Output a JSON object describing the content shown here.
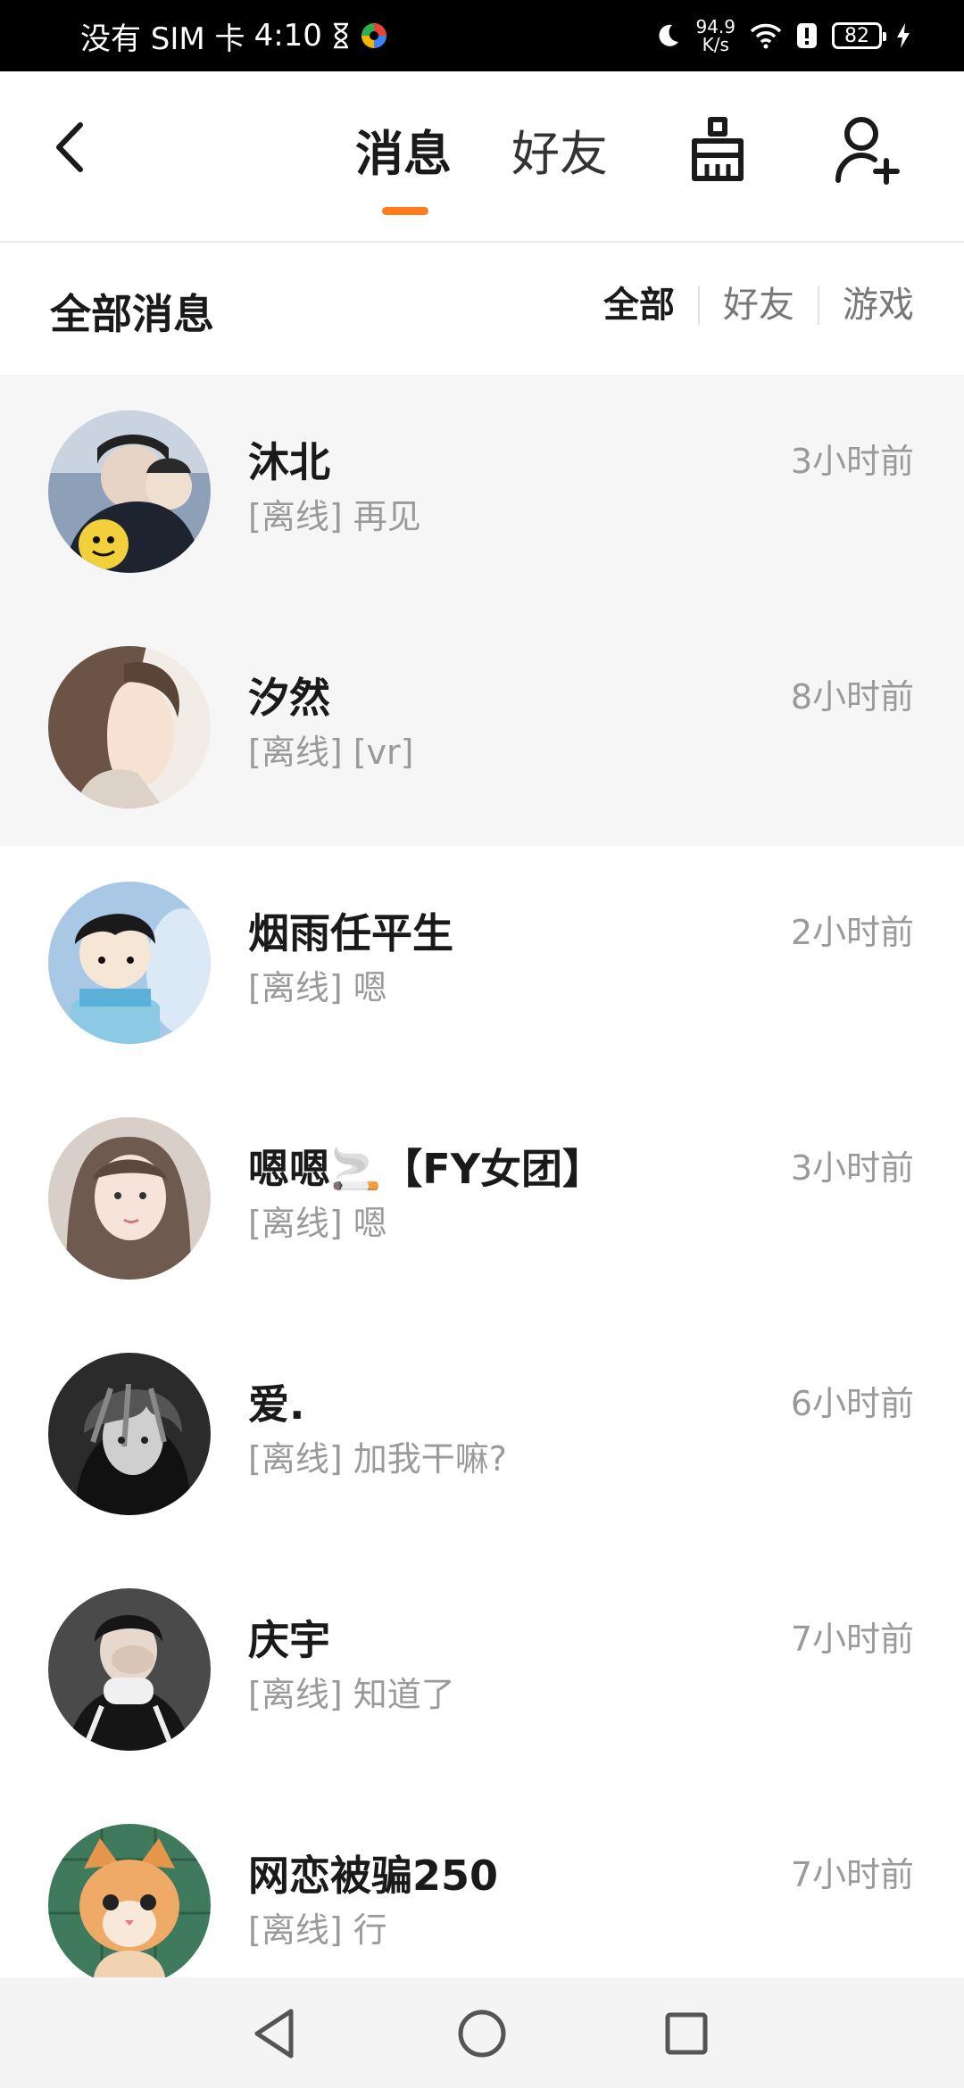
{
  "status_bar": {
    "carrier": "没有 SIM 卡",
    "time": "4:10",
    "net_speed_value": "94.9",
    "net_speed_unit": "K/s",
    "battery": "82"
  },
  "header": {
    "tabs": [
      {
        "label": "消息",
        "active": true
      },
      {
        "label": "好友",
        "active": false
      }
    ],
    "accent_color": "#ff7a1a"
  },
  "filter": {
    "title": "全部消息",
    "options": [
      {
        "label": "全部",
        "active": true
      },
      {
        "label": "好友",
        "active": false
      },
      {
        "label": "游戏",
        "active": false
      }
    ]
  },
  "messages": [
    {
      "name": "沐北",
      "preview": "[离线] 再见",
      "time": "3小时前",
      "pinned": true
    },
    {
      "name": "汐然",
      "preview": "[离线] [vr]",
      "time": "8小时前",
      "pinned": true
    },
    {
      "name": "烟雨任平生",
      "preview": "[离线] 嗯",
      "time": "2小时前",
      "pinned": false
    },
    {
      "name": "嗯嗯🚬【FY女团】",
      "preview": "[离线] 嗯",
      "time": "3小时前",
      "pinned": false
    },
    {
      "name": "爱.",
      "preview": "[离线] 加我干嘛?",
      "time": "6小时前",
      "pinned": false
    },
    {
      "name": "庆宇",
      "preview": "[离线] 知道了",
      "time": "7小时前",
      "pinned": false
    },
    {
      "name": "网恋被骗250",
      "preview": "[离线] 行",
      "time": "7小时前",
      "pinned": false
    }
  ]
}
